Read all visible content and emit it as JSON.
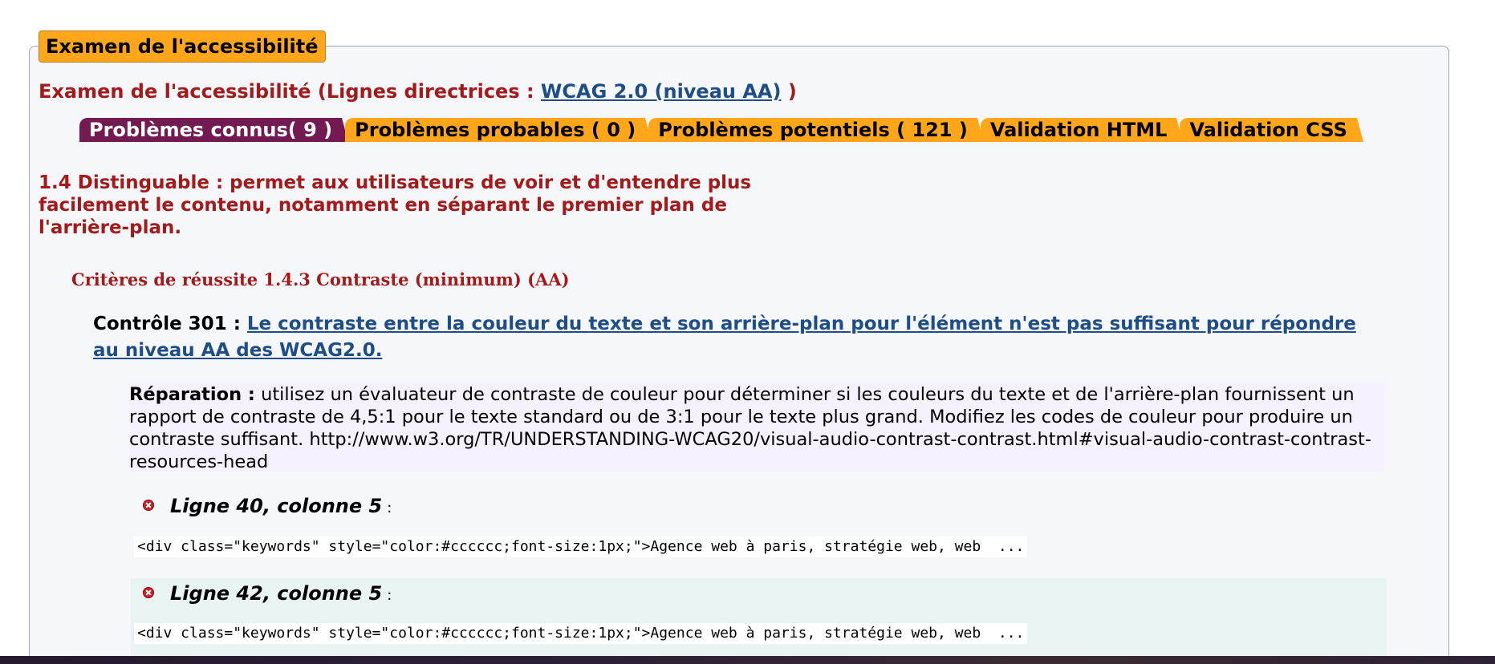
{
  "fieldset": {
    "legend": "Examen de l'accessibilité"
  },
  "review": {
    "title_prefix": "Examen de l'accessibilité (Lignes directrices : ",
    "guideline_link": "WCAG 2.0 (niveau AA)",
    "title_suffix": " )"
  },
  "tabs": [
    {
      "label": "Problèmes connus( 9 )",
      "active": true
    },
    {
      "label": "Problèmes probables ( 0 )",
      "active": false
    },
    {
      "label": "Problèmes potentiels ( 121 )",
      "active": false
    },
    {
      "label": "Validation HTML",
      "active": false
    },
    {
      "label": "Validation CSS",
      "active": false
    }
  ],
  "guideline": {
    "text": "1.4 Distinguable : permet aux utilisateurs de voir et d'entendre plus facilement le contenu, notamment en séparant le premier plan de l'arrière-plan."
  },
  "criteria": {
    "text": "Critères de réussite 1.4.3 Contraste (minimum) (AA)"
  },
  "check": {
    "label": "Contrôle 301 : ",
    "link": "Le contraste entre la couleur du texte et son arrière-plan pour l'élément n'est pas suffisant pour répondre au niveau AA des WCAG2.0."
  },
  "repair": {
    "label": "Réparation :",
    "text": " utilisez un évaluateur de contraste de couleur pour déterminer si les couleurs du texte et de l'arrière-plan fournissent un rapport de contraste de 4,5:1 pour le texte standard ou de 3:1 pour le texte plus grand. Modifiez les codes de couleur pour produire un contraste suffisant. http://www.w3.org/TR/UNDERSTANDING-WCAG20/visual-audio-contrast-contrast.html#visual-audio-contrast-contrast-resources-head"
  },
  "issues": [
    {
      "location": "Ligne 40, colonne 5",
      "colon": ":",
      "code": "<div class=\"keywords\" style=\"color:#cccccc;font-size:1px;\">Agence web à paris, stratégie web, web  ..."
    },
    {
      "location": "Ligne 42, colonne 5",
      "colon": ":",
      "code": "<div class=\"keywords\" style=\"color:#cccccc;font-size:1px;\">Agence web à paris, stratégie web, web  ..."
    }
  ],
  "colors": {
    "accent_orange": "#ffa61a",
    "active_tab": "#741a52",
    "heading_red": "#a31a1a",
    "link_blue": "#1f4e86",
    "error_red": "#c6242c"
  },
  "icons": {
    "error": "error-x-icon"
  }
}
